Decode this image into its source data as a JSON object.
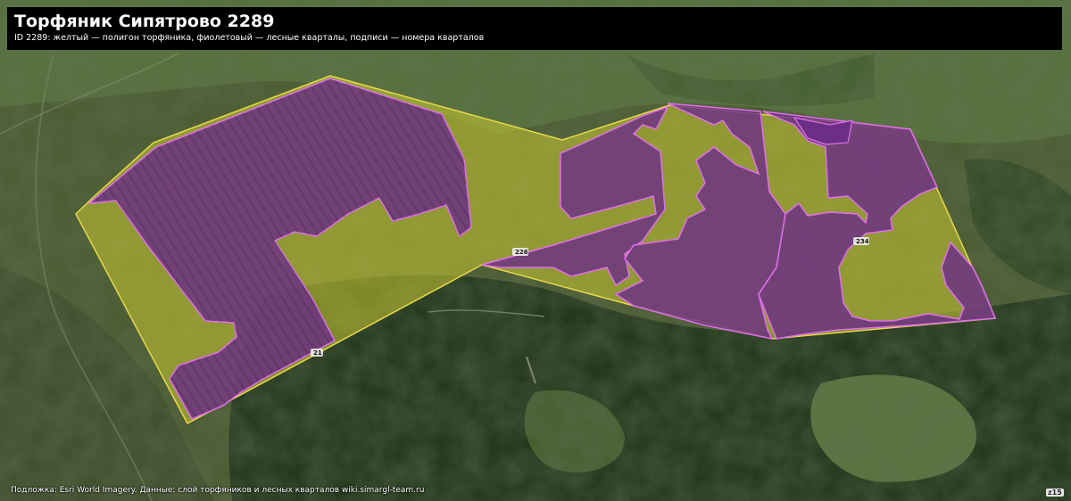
{
  "header": {
    "title": "Торфяник Сипятрово 2289",
    "subtitle": "ID 2289: желтый — полигон торфяника, фиолетовый — лесные кварталы, подписи — номера кварталов"
  },
  "quarter_labels": [
    "21",
    "226",
    "234"
  ],
  "credit": "Подложка: Esri World Imagery. Данные: слой торфяников и лесных кварталов wiki.simargl-team.ru",
  "corner_label": "z15",
  "colors": {
    "peat_outline": "#e8d84a",
    "peat_fill": "#c8c832",
    "forest_fill": "#6a2a8a",
    "forest_outline": "#e070e8",
    "header_bg": "#000000"
  }
}
